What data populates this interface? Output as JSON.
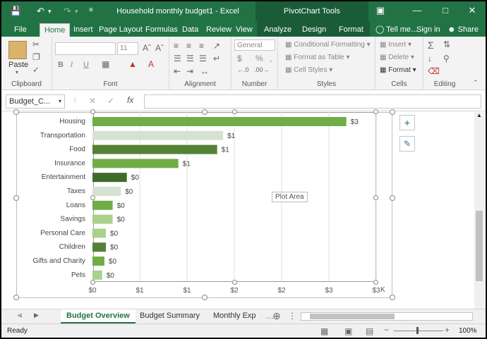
{
  "titlebar": {
    "doc_title": "Household monthly budget1 - Excel",
    "context_title": "PivotChart Tools"
  },
  "tabs": [
    "File",
    "Home",
    "Insert",
    "Page Layout",
    "Formulas",
    "Data",
    "Review",
    "View",
    "Analyze",
    "Design",
    "Format"
  ],
  "tell_me": "Tell me...",
  "sign_in": "Sign in",
  "share": "Share",
  "ribbon": {
    "clipboard": {
      "label": "Clipboard",
      "paste": "Paste"
    },
    "font": {
      "label": "Font",
      "size": "11",
      "bold": "B",
      "italic": "I",
      "underline": "U"
    },
    "alignment": {
      "label": "Alignment"
    },
    "number": {
      "label": "Number",
      "format": "General",
      "dollar": "$",
      "percent": "%",
      "comma": ","
    },
    "styles": {
      "label": "Styles",
      "conditional": "Conditional Formatting",
      "format_table": "Format as Table",
      "cell_styles": "Cell Styles"
    },
    "cells": {
      "label": "Cells",
      "insert": "Insert",
      "delete": "Delete",
      "format": "Format"
    },
    "editing": {
      "label": "Editing"
    }
  },
  "formula_bar": {
    "name_box": "Budget_C...",
    "fx": "fx",
    "value": ""
  },
  "plot_area_tooltip": "Plot Area",
  "chart_data": {
    "type": "bar",
    "orientation": "horizontal",
    "categories": [
      "Housing",
      "Transportation",
      "Food",
      "Insurance",
      "Entertainment",
      "Taxes",
      "Loans",
      "Savings",
      "Personal Care",
      "Children",
      "Gifts and Charity",
      "Pets"
    ],
    "values": [
      3.4,
      1.75,
      1.67,
      1.15,
      0.46,
      0.38,
      0.27,
      0.27,
      0.18,
      0.18,
      0.16,
      0.13
    ],
    "data_labels": [
      "$3",
      "$1",
      "$1",
      "$1",
      "$0",
      "$0",
      "$0",
      "$0",
      "$0",
      "$0",
      "$0",
      "$0"
    ],
    "colors": [
      "#70ad47",
      "#d6e2d1",
      "#548235",
      "#70ad47",
      "#3e6b2a",
      "#d6e2d1",
      "#70ad47",
      "#a9d18e",
      "#a9d18e",
      "#548235",
      "#70ad47",
      "#a9d18e"
    ],
    "x_ticks": [
      "$0",
      "$1",
      "$1",
      "$2",
      "$2",
      "$3",
      "$3"
    ],
    "x_unit": "K",
    "xlim": [
      0,
      3.8
    ],
    "grid": true
  },
  "sheet_tabs": [
    "Budget Overview",
    "Budget Summary",
    "Monthly Exp"
  ],
  "active_sheet": "Budget Overview",
  "status": {
    "ready": "Ready",
    "zoom": "100%"
  }
}
